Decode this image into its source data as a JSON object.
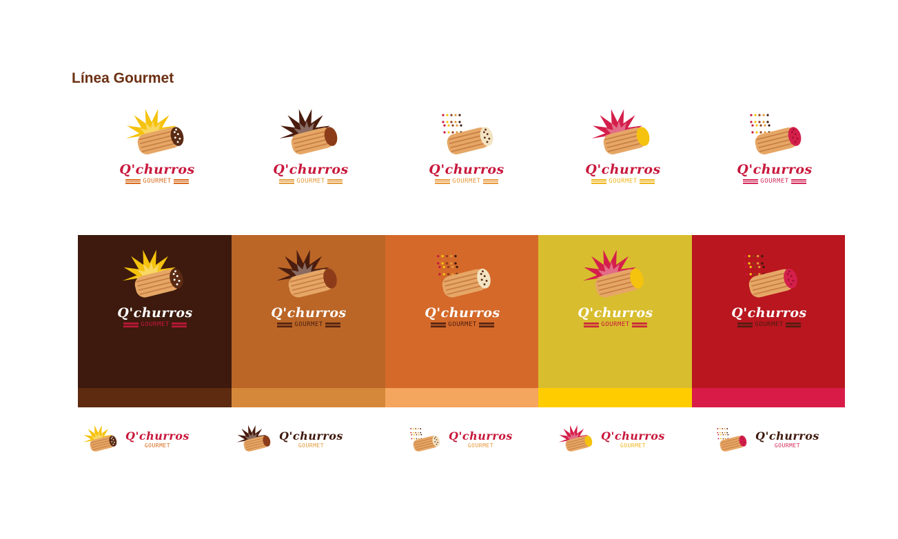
{
  "page_title": "Línea Gourmet",
  "brand_name": "Q'churros",
  "brand_sub": "GOURMET",
  "colors": {
    "title": "#6b2f12",
    "brand_red": "#c8183c",
    "dark_brown": "#3f1a0e",
    "churro": "#e6a766",
    "churro_line": "#c97f45"
  },
  "variants": [
    {
      "id": "chocolate-sprinkles",
      "icon": "burst-churro-chocolate-icon",
      "burst": "#f5c20e",
      "tip": "#5a2b14",
      "tip_dots": "#ffffff",
      "sprinkles": false,
      "sub_color": "#d96a1b",
      "panel_bg": "#3d1a0d",
      "panel_band": "#5e2a10",
      "panel_sub": "#c8183c"
    },
    {
      "id": "dulce",
      "icon": "burst-churro-dulce-icon",
      "burst": "#4a1d0f",
      "tip": "#8c3c19",
      "tip_dots": null,
      "sprinkles": false,
      "sub_color": "#e39a3b",
      "panel_bg": "#bb6627",
      "panel_band": "#d6883a",
      "panel_sub": "#4a1d0f"
    },
    {
      "id": "confetti",
      "icon": "sprinkle-churro-icon",
      "burst": null,
      "tip": "#f2e3c2",
      "tip_dots": "#5a2b14",
      "sprinkles": true,
      "sub_color": "#e8973a",
      "panel_bg": "#d4692a",
      "panel_band": "#f4a55e",
      "panel_sub": "#4a1d0f"
    },
    {
      "id": "vanilla",
      "icon": "burst-churro-vanilla-icon",
      "burst": "#d41f4b",
      "tip": "#f5c20e",
      "tip_dots": null,
      "sprinkles": false,
      "sub_color": "#f0b41a",
      "panel_bg": "#d8bd2e",
      "panel_band": "#ffcc00",
      "panel_sub": "#c8183c"
    },
    {
      "id": "berry",
      "icon": "sprinkle-churro-berry-icon",
      "burst": null,
      "tip": "#d41f4b",
      "tip_dots": "#a01030",
      "sprinkles": true,
      "sub_color": "#d42a5a",
      "panel_bg": "#b9161f",
      "panel_band": "#d81c47",
      "panel_sub": "#4a1d0f"
    }
  ]
}
